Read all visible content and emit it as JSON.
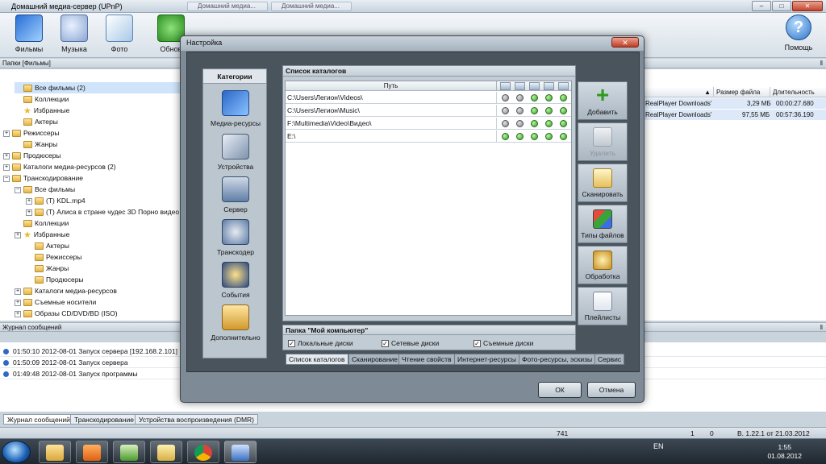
{
  "app": {
    "title": "Домашний медиа-сервер (UPnP)",
    "ghost_tabs": [
      "Домашний медиа...",
      "Домашний медиа..."
    ],
    "toolbar": {
      "films": "Фильмы",
      "music": "Музыка",
      "photo": "Фото",
      "refresh": "Обнов",
      "help": "Помощь"
    },
    "folders_header": "Папки [Фильмы]",
    "tree": [
      {
        "label": "Все фильмы (2)",
        "indent": 1,
        "expander": "",
        "icon": "folder",
        "selected": true
      },
      {
        "label": "Коллекции",
        "indent": 1,
        "expander": "",
        "icon": "folder"
      },
      {
        "label": "Избранные",
        "indent": 1,
        "expander": "",
        "icon": "star"
      },
      {
        "label": "Актеры",
        "indent": 1,
        "expander": "",
        "icon": "folder"
      },
      {
        "label": "Режиссеры",
        "indent": 0,
        "expander": "+",
        "icon": "folder"
      },
      {
        "label": "Жанры",
        "indent": 1,
        "expander": "",
        "icon": "folder"
      },
      {
        "label": "Продюсеры",
        "indent": 0,
        "expander": "+",
        "icon": "folder"
      },
      {
        "label": "Каталоги медиа-ресурсов (2)",
        "indent": 0,
        "expander": "+",
        "icon": "folder"
      },
      {
        "label": "Транскодирование",
        "indent": 0,
        "expander": "−",
        "icon": "folder"
      },
      {
        "label": "Все фильмы",
        "indent": 1,
        "expander": "−",
        "icon": "folder"
      },
      {
        "label": "(T) KDL.mp4",
        "indent": 2,
        "expander": "+",
        "icon": "folder"
      },
      {
        "label": "(T) Алиса в стране чудес 3D Порно видео П",
        "indent": 2,
        "expander": "+",
        "icon": "folder"
      },
      {
        "label": "Коллекции",
        "indent": 1,
        "expander": "",
        "icon": "folder"
      },
      {
        "label": "Избранные",
        "indent": 1,
        "expander": "+",
        "icon": "star"
      },
      {
        "label": "Актеры",
        "indent": 2,
        "expander": "",
        "icon": "folder"
      },
      {
        "label": "Режиссеры",
        "indent": 2,
        "expander": "",
        "icon": "folder"
      },
      {
        "label": "Жанры",
        "indent": 2,
        "expander": "",
        "icon": "folder"
      },
      {
        "label": "Продюсеры",
        "indent": 2,
        "expander": "",
        "icon": "folder"
      },
      {
        "label": "Каталоги медиа-ресурсов",
        "indent": 1,
        "expander": "+",
        "icon": "folder"
      },
      {
        "label": "Съемные носители",
        "indent": 1,
        "expander": "+",
        "icon": "folder"
      },
      {
        "label": "Образы CD/DVD/BD (ISO)",
        "indent": 1,
        "expander": "+",
        "icon": "folder"
      }
    ],
    "list": {
      "columns": [
        "Размер файла",
        "Длительность"
      ],
      "rows": [
        {
          "source": "RealPlayer Downloads'",
          "size": "3,29 МБ",
          "duration": "00:00:27.680"
        },
        {
          "source": "RealPlayer Downloads'",
          "size": "97,55 МБ",
          "duration": "00:57:36.190"
        }
      ]
    },
    "journal_header": "Журнал сообщений",
    "journal": [
      "01:50:10 2012-08-01 Запуск сервера [192.168.2.101]",
      "01:50:09 2012-08-01 Запуск сервера",
      "01:49:48 2012-08-01 Запуск программы"
    ],
    "bottom_tabs": [
      "Журнал сообщений",
      "Транскодирование",
      "Устройства воспроизведения (DMR)"
    ],
    "status": {
      "count": "741",
      "n1": "1",
      "n0": "0",
      "version": "В. 1.22.1 от 21.03.2012"
    }
  },
  "dialog": {
    "title": "Настройка",
    "categories_title": "Категории",
    "categories": [
      "Медиа-ресурсы",
      "Устройства",
      "Сервер",
      "Транскодер",
      "События",
      "Дополнительно"
    ],
    "catalog_title": "Список каталогов",
    "path_header": "Путь",
    "catalog_rows": [
      {
        "path": "C:\\Users\\Легион\\Videos\\",
        "flags": [
          false,
          false,
          true,
          true,
          true
        ]
      },
      {
        "path": "C:\\Users\\Легион\\Music\\",
        "flags": [
          false,
          false,
          true,
          true,
          true
        ]
      },
      {
        "path": "F:\\Multimedia\\Video\\Видео\\",
        "flags": [
          false,
          false,
          true,
          true,
          true
        ]
      },
      {
        "path": "E:\\",
        "flags": [
          true,
          true,
          true,
          true,
          true
        ]
      }
    ],
    "buttons": {
      "add": "Добавить",
      "delete": "Удалить",
      "scan": "Сканировать",
      "types": "Типы файлов",
      "process": "Обработка",
      "playlists": "Плейлисты"
    },
    "my_computer_title": "Папка \"Мой компьютер\"",
    "checks": [
      {
        "label": "Локальные диски",
        "checked": true
      },
      {
        "label": "Сетевые диски",
        "checked": true
      },
      {
        "label": "Съемные диски",
        "checked": true
      }
    ],
    "tabs": [
      "Список каталогов",
      "Сканирование",
      "Чтение свойств",
      "Интернет-ресурсы",
      "Фото-ресурсы, эскизы",
      "Сервис"
    ],
    "ok": "ОК",
    "cancel": "Отмена"
  },
  "taskbar": {
    "lang": "EN",
    "time": "1:55",
    "date": "01.08.2012"
  }
}
